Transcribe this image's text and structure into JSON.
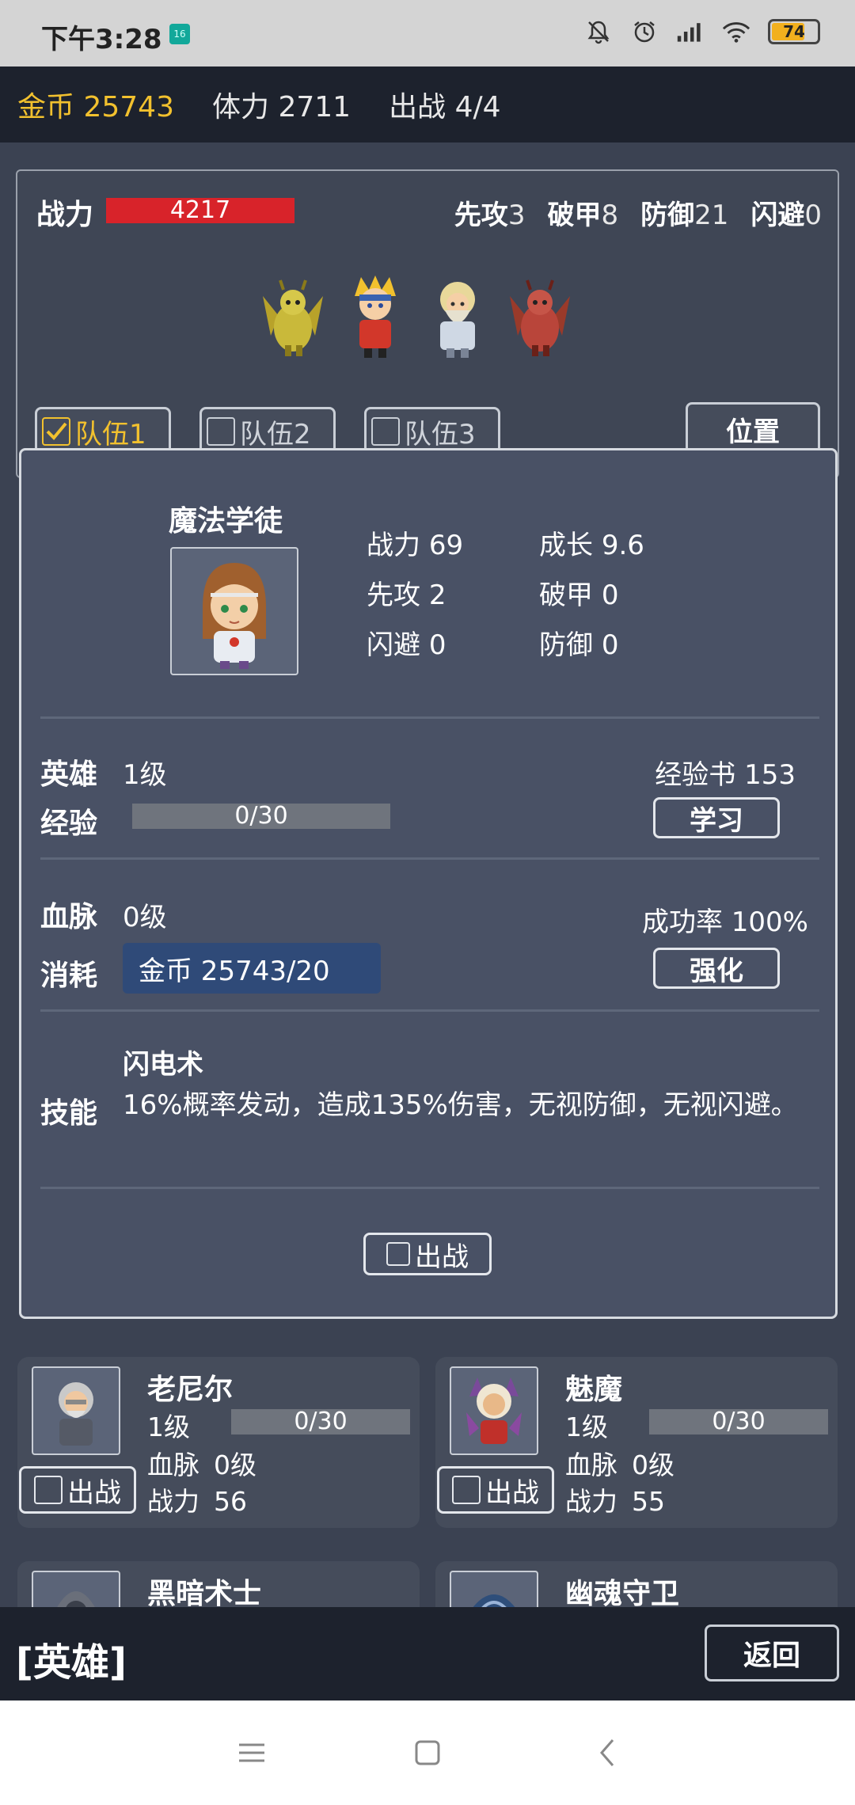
{
  "status_bar": {
    "time": "下午3:28",
    "badge": "16",
    "battery": "74",
    "battery_level": 0.74
  },
  "resources": {
    "gold_label": "金币",
    "gold": "25743",
    "stamina_label": "体力",
    "stamina": "2711",
    "deploy_label": "出战",
    "deploy": "4/4"
  },
  "team": {
    "power_label": "战力",
    "power": "4217",
    "attrs": [
      {
        "label": "先攻",
        "value": "3"
      },
      {
        "label": "破甲",
        "value": "8"
      },
      {
        "label": "防御",
        "value": "21"
      },
      {
        "label": "闪避",
        "value": "0"
      }
    ],
    "tabs": [
      {
        "label": "队伍1",
        "checked": true
      },
      {
        "label": "队伍2",
        "checked": false
      },
      {
        "label": "队伍3",
        "checked": false
      }
    ],
    "position_button": "位置"
  },
  "detail": {
    "name": "魔法学徒",
    "stats": [
      {
        "label": "战力",
        "value": "69"
      },
      {
        "label": "成长",
        "value": "9.6"
      },
      {
        "label": "先攻",
        "value": "2"
      },
      {
        "label": "破甲",
        "value": "0"
      },
      {
        "label": "闪避",
        "value": "0"
      },
      {
        "label": "防御",
        "value": "0"
      }
    ],
    "hero_label": "英雄",
    "hero_level": "1级",
    "exp_book": "经验书 153",
    "exp_label": "经验",
    "exp": "0/30",
    "exp_fraction": 0,
    "learn_button": "学习",
    "vein_label": "血脉",
    "vein_level": "0级",
    "success_rate": "成功率 100%",
    "cost_label": "消耗",
    "cost": "金币 25743/20",
    "enhance_button": "强化",
    "skill_label": "技能",
    "skill_name": "闪电术",
    "skill_desc": "16%概率发动，造成135%伤害，无视防御，无视闪避。",
    "deploy_button": "出战"
  },
  "cards": [
    {
      "name": "老尼尔",
      "level": "1级",
      "exp": "0/30",
      "vein_label": "血脉",
      "vein": "0级",
      "power_label": "战力",
      "power": "56",
      "button": "出战"
    },
    {
      "name": "魅魔",
      "level": "1级",
      "exp": "0/30",
      "vein_label": "血脉",
      "vein": "0级",
      "power_label": "战力",
      "power": "55",
      "button": "出战"
    },
    {
      "name": "黑暗术士"
    },
    {
      "name": "幽魂守卫"
    }
  ],
  "bottom": {
    "title": "[英雄]",
    "back": "返回"
  },
  "colors": {
    "gold": "#f2c12e",
    "power_bar": "#d8232a",
    "cost_box": "#2f4a78",
    "panel": "#495165"
  }
}
